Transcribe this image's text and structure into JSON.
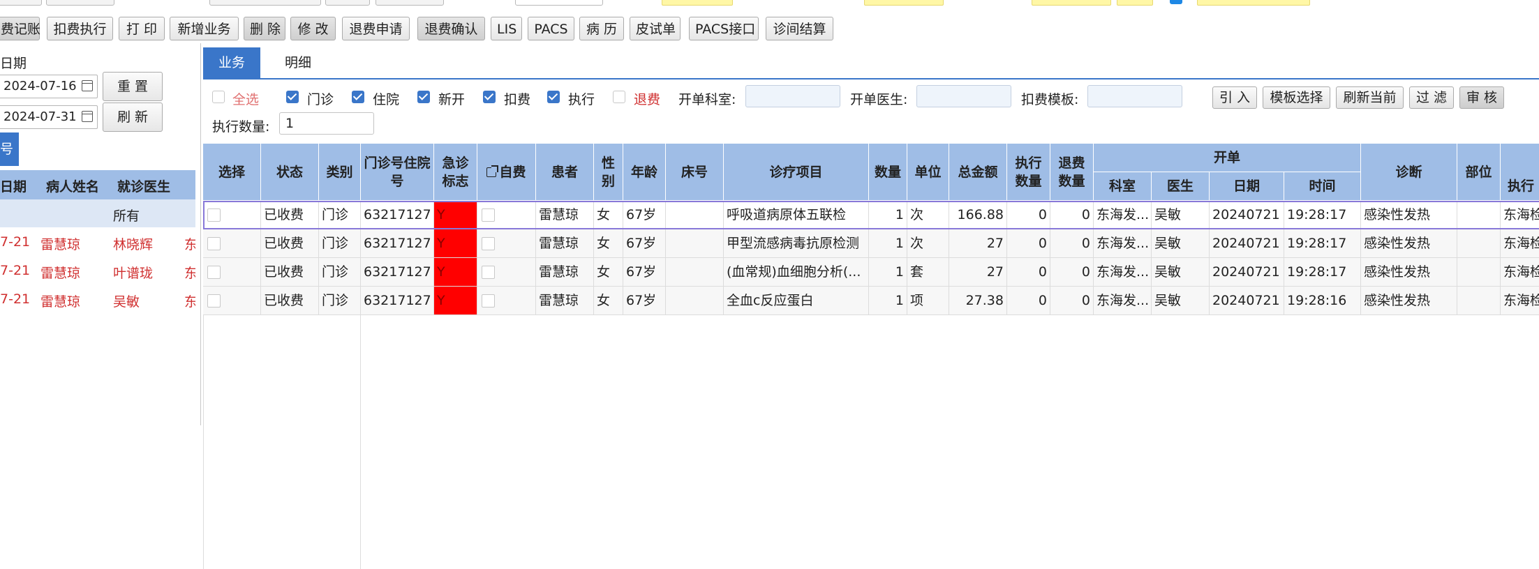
{
  "toolbar": {
    "buttons": [
      "费记账",
      "扣费执行",
      "打 印",
      "新增业务",
      "删 除",
      "修 改",
      "退费申请",
      "退费确认",
      "LIS",
      "PACS",
      "病 历",
      "皮试单",
      "PACS接口",
      "诊间结算"
    ]
  },
  "left_panel": {
    "date_label": "日期",
    "start_date": "2024-07-16",
    "end_date": "2024-07-31",
    "reset_label": "重 置",
    "refresh_label": "刷 新",
    "tab_label": "号",
    "columns": [
      "日期",
      "病人姓名",
      "就诊医生"
    ],
    "filter_value": "所有",
    "rows": [
      {
        "date": "7-21",
        "name": "雷慧琼",
        "doctor": "林晓辉",
        "extra": "东"
      },
      {
        "date": "7-21",
        "name": "雷慧琼",
        "doctor": "叶谱珑",
        "extra": "东"
      },
      {
        "date": "7-21",
        "name": "雷慧琼",
        "doctor": "吴敏",
        "extra": "东"
      }
    ]
  },
  "tabs": {
    "business": "业务",
    "detail": "明细"
  },
  "filters": {
    "select_all": "全选",
    "checks": [
      {
        "label": "门诊",
        "checked": true
      },
      {
        "label": "住院",
        "checked": true
      },
      {
        "label": "新开",
        "checked": true
      },
      {
        "label": "扣费",
        "checked": true
      },
      {
        "label": "执行",
        "checked": true
      },
      {
        "label": "退费",
        "checked": false
      }
    ],
    "dept_label": "开单科室:",
    "doctor_label": "开单医生:",
    "template_label": "扣费模板:",
    "exec_qty_label": "执行数量:",
    "exec_qty_value": "1",
    "buttons": [
      "引 入",
      "模板选择",
      "刷新当前",
      "过 滤",
      "审 核"
    ]
  },
  "grid": {
    "headers": [
      "选择",
      "状态",
      "类别",
      "门诊号住院号",
      "急诊标志",
      "自费",
      "患者",
      "性别",
      "年龄",
      "床号",
      "诊疗项目",
      "数量",
      "单位",
      "总金额",
      "执行数量",
      "退费数量",
      "开单",
      "诊断",
      "部位",
      "执行"
    ],
    "sub_headers": [
      "科室",
      "医生",
      "日期",
      "时间"
    ],
    "rows": [
      {
        "status": "已收费",
        "type": "门诊",
        "no": "63217127",
        "urgent": "Y",
        "patient": "雷慧琼",
        "sex": "女",
        "age": "67岁",
        "bed": "",
        "item": "呼吸道病原体五联检",
        "qty": "1",
        "unit": "次",
        "amount": "166.88",
        "exec": "0",
        "refund": "0",
        "dept": "东海发...",
        "doctor": "吴敏",
        "date": "20240721",
        "time": "19:28:17",
        "diag": "感染性发热",
        "part": "",
        "execdept": "东海检"
      },
      {
        "status": "已收费",
        "type": "门诊",
        "no": "63217127",
        "urgent": "Y",
        "patient": "雷慧琼",
        "sex": "女",
        "age": "67岁",
        "bed": "",
        "item": "甲型流感病毒抗原检测",
        "qty": "1",
        "unit": "次",
        "amount": "27",
        "exec": "0",
        "refund": "0",
        "dept": "东海发...",
        "doctor": "吴敏",
        "date": "20240721",
        "time": "19:28:17",
        "diag": "感染性发热",
        "part": "",
        "execdept": "东海检"
      },
      {
        "status": "已收费",
        "type": "门诊",
        "no": "63217127",
        "urgent": "Y",
        "patient": "雷慧琼",
        "sex": "女",
        "age": "67岁",
        "bed": "",
        "item": "(血常规)血细胞分析(...",
        "qty": "1",
        "unit": "套",
        "amount": "27",
        "exec": "0",
        "refund": "0",
        "dept": "东海发...",
        "doctor": "吴敏",
        "date": "20240721",
        "time": "19:28:17",
        "diag": "感染性发热",
        "part": "",
        "execdept": "东海检"
      },
      {
        "status": "已收费",
        "type": "门诊",
        "no": "63217127",
        "urgent": "Y",
        "patient": "雷慧琼",
        "sex": "女",
        "age": "67岁",
        "bed": "",
        "item": "全血c反应蛋白",
        "qty": "1",
        "unit": "项",
        "amount": "27.38",
        "exec": "0",
        "refund": "0",
        "dept": "东海发...",
        "doctor": "吴敏",
        "date": "20240721",
        "time": "19:28:16",
        "diag": "感染性发热",
        "part": "",
        "execdept": "东海检"
      }
    ]
  },
  "colors": {
    "accent": "#3a76c9",
    "header_bg": "#9fbde6",
    "urgent": "#ff0000",
    "red_text": "#d03030"
  }
}
